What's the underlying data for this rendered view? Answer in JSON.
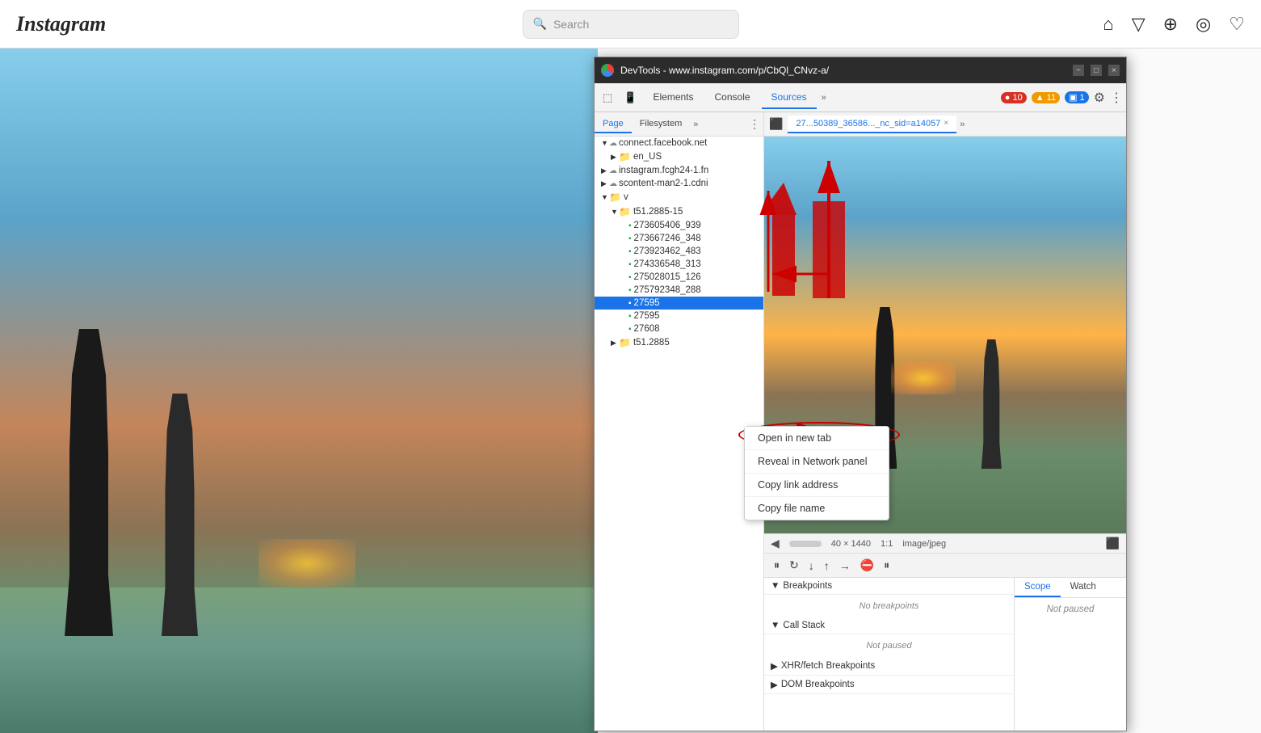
{
  "header": {
    "logo": "Instagram",
    "search_placeholder": "Search",
    "nav_icons": [
      "home",
      "send",
      "add-circle",
      "explore",
      "heart"
    ]
  },
  "devtools": {
    "title": "DevTools - www.instagram.com/p/CbQl_CNvz-a/",
    "tabs": [
      "Elements",
      "Console",
      "Sources"
    ],
    "active_tab": "Sources",
    "tab_more": "»",
    "badges": {
      "errors": "● 10",
      "warnings": "▲ 11",
      "blue": "▣ 1"
    },
    "file_panel": {
      "tabs": [
        "Page",
        "Filesystem",
        "»"
      ],
      "active_tab": "Page",
      "tree": [
        {
          "level": 1,
          "type": "cloud-folder",
          "name": "connect.facebook.net",
          "arrow": "▼"
        },
        {
          "level": 2,
          "type": "folder",
          "name": "en_US",
          "arrow": "▶"
        },
        {
          "level": 1,
          "type": "cloud-folder",
          "name": "instagram.fcgh24-1.fn",
          "arrow": "▶"
        },
        {
          "level": 1,
          "type": "cloud-folder",
          "name": "scontent-man2-1.cdni",
          "arrow": "▶"
        },
        {
          "level": 1,
          "type": "folder",
          "name": "v",
          "arrow": "▼"
        },
        {
          "level": 2,
          "type": "folder",
          "name": "t51.2885-15",
          "arrow": "▼"
        },
        {
          "level": 3,
          "type": "file",
          "name": "273605406_939",
          "selected": false
        },
        {
          "level": 3,
          "type": "file",
          "name": "273667246_348",
          "selected": false
        },
        {
          "level": 3,
          "type": "file",
          "name": "273923462_483",
          "selected": false
        },
        {
          "level": 3,
          "type": "file",
          "name": "274336548_313",
          "selected": false
        },
        {
          "level": 3,
          "type": "file",
          "name": "275028015_126",
          "selected": false
        },
        {
          "level": 3,
          "type": "file",
          "name": "275792348_288",
          "selected": false
        },
        {
          "level": 3,
          "type": "file",
          "name": "27595",
          "selected": true
        },
        {
          "level": 3,
          "type": "file",
          "name": "27595",
          "selected": false
        },
        {
          "level": 3,
          "type": "file",
          "name": "27608",
          "selected": false
        },
        {
          "level": 2,
          "type": "folder",
          "name": "t51.2885",
          "arrow": "▶"
        }
      ]
    },
    "source_tab": {
      "label": "27...50389_36586..._nc_sid=a14057",
      "close": "×"
    },
    "status_bar": {
      "dimensions": "40 × 1440",
      "zoom": "1:1",
      "mime": "image/jpeg",
      "icon": "⬛"
    },
    "debug_toolbar": {
      "pause": "⏸",
      "step_over": "↩",
      "step_into": "↓",
      "step_out": "↑",
      "step": "→",
      "deactivate": "⛔",
      "pause_on_exceptions": "⏸"
    },
    "breakpoints_header": "Breakpoints",
    "breakpoints_content": "No breakpoints",
    "call_stack_header": "Call Stack",
    "call_stack_content": "Not paused",
    "xhr_header": "XHR/fetch Breakpoints",
    "dom_header": "DOM Breakpoints",
    "scope_tab": "Scope",
    "watch_tab": "Watch",
    "not_paused": "Not paused"
  },
  "context_menu": {
    "items": [
      {
        "label": "Open in new tab",
        "highlighted": true
      },
      {
        "label": "Reveal in Network panel",
        "highlighted": false
      },
      {
        "label": "Copy link address",
        "highlighted": false
      },
      {
        "label": "Copy file name",
        "highlighted": false
      }
    ]
  }
}
